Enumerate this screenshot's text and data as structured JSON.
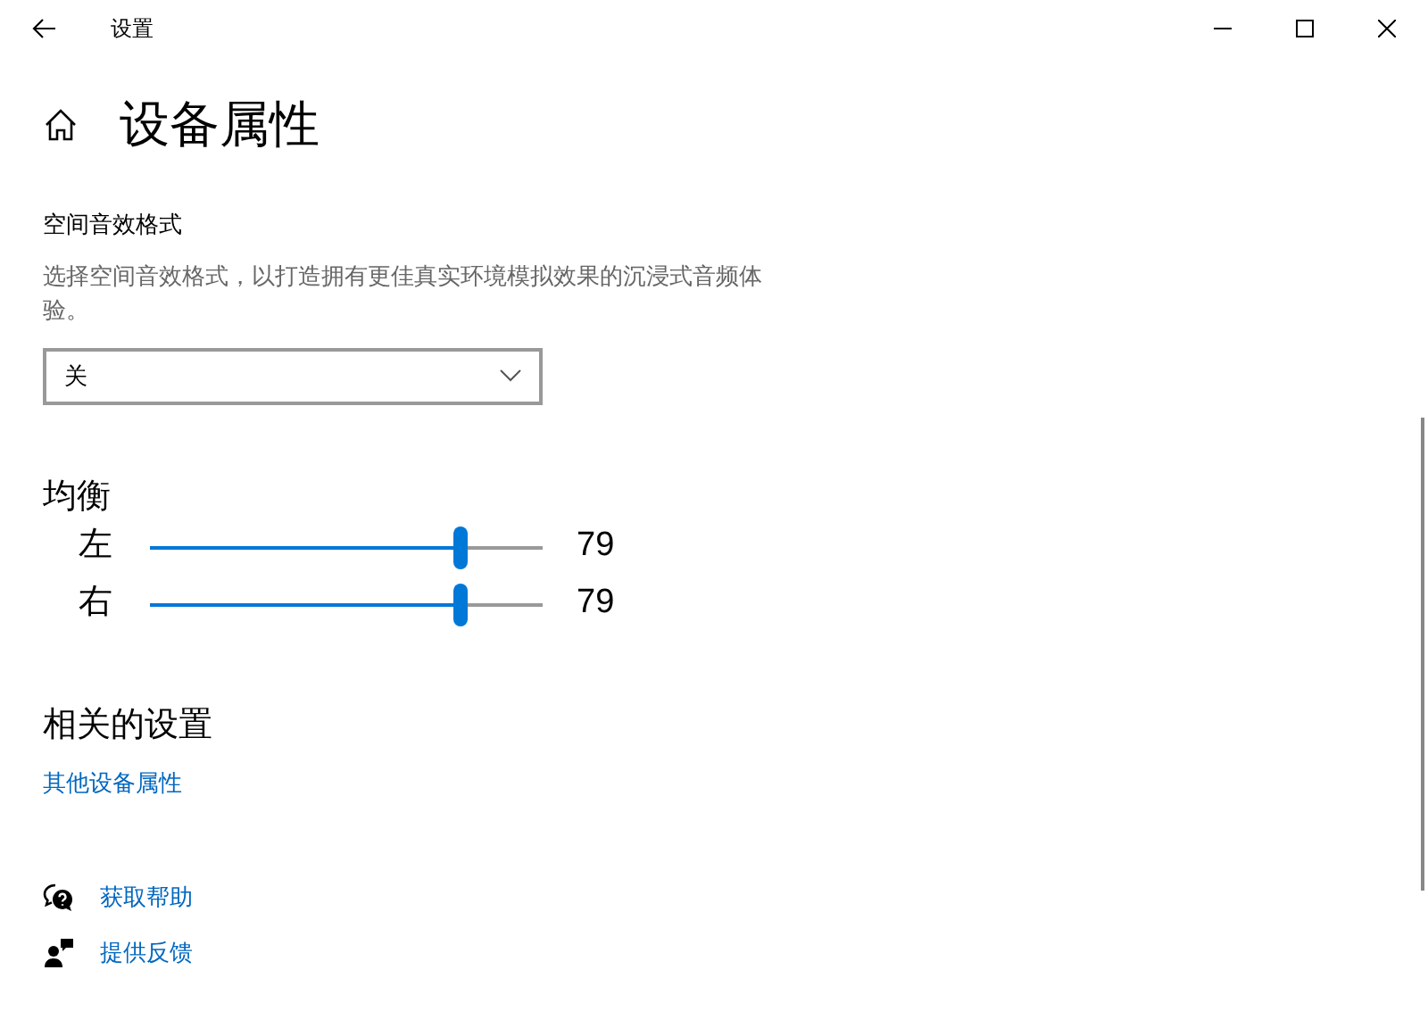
{
  "window": {
    "title": "设置"
  },
  "page_title": "设备属性",
  "spatial": {
    "label": "空间音效格式",
    "description": "选择空间音效格式，以打造拥有更佳真实环境模拟效果的沉浸式音频体验。",
    "dropdown": {
      "value": "关"
    }
  },
  "balance": {
    "title": "均衡",
    "channels": [
      {
        "name": "左",
        "level": 0.79,
        "reading": "79"
      },
      {
        "name": "右",
        "level": 0.79,
        "reading": "79"
      }
    ]
  },
  "related": {
    "title": "相关的设置",
    "links": [
      "其他设备属性"
    ]
  },
  "footer_links": [
    {
      "kind": "help",
      "label": "获取帮助"
    },
    {
      "kind": "feedback",
      "label": "提供反馈"
    }
  ]
}
